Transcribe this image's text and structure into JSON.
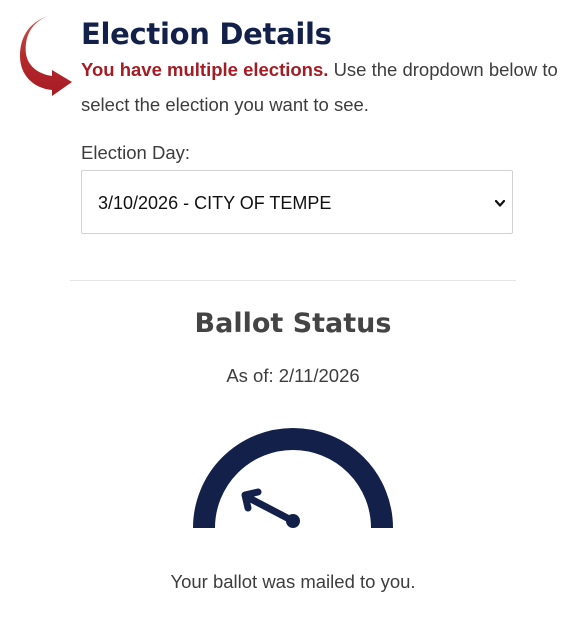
{
  "header": {
    "title": "Election Details",
    "warning": "You have multiple elections.",
    "instructions": "Use the dropdown below to select the election you want to see."
  },
  "election_select": {
    "label": "Election Day:",
    "selected": "3/10/2026 - CITY OF TEMPE"
  },
  "ballot_status": {
    "title": "Ballot Status",
    "as_of": "As of: 2/11/2026",
    "message": "Your ballot was mailed to you."
  },
  "colors": {
    "navy": "#13214a",
    "warning_red": "#a51c24",
    "arrow_red": "#b7282e"
  },
  "icons": {
    "arrow": "curved-arrow-icon",
    "dropdown": "chevron-down-icon",
    "gauge": "gauge-icon"
  }
}
